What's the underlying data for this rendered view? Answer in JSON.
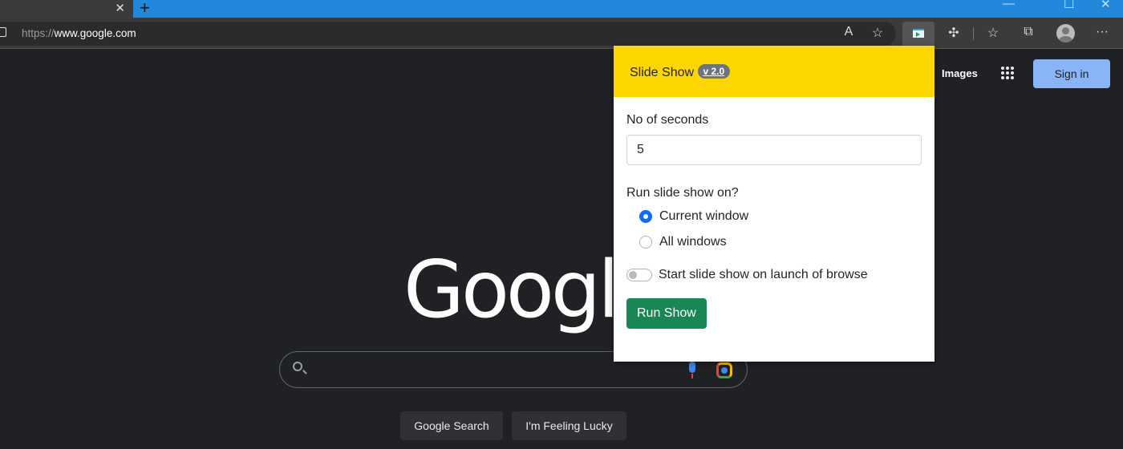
{
  "browser": {
    "tab_close": "✕",
    "new_tab": "+",
    "url_scheme": "https://",
    "url_host": "www.google.com",
    "window_controls": {
      "minimize": "—",
      "maximize": "☐",
      "close": "✕"
    },
    "toolbar_icons": [
      "read-aloud-icon",
      "add-favorite-icon",
      "slideshow-extension-icon",
      "extensions-icon",
      "favorites-icon",
      "collections-icon",
      "profile-icon",
      "more-icon"
    ]
  },
  "google": {
    "images_link": "Images",
    "sign_in": "Sign in",
    "logo": "Google",
    "search_button": "Google Search",
    "lucky_button": "I'm Feeling Lucky"
  },
  "popup": {
    "title": "Slide Show",
    "version": "v 2.0",
    "seconds_label": "No of seconds",
    "seconds_value": "5",
    "run_on_label": "Run slide show on?",
    "options": [
      {
        "label": "Current window",
        "checked": true
      },
      {
        "label": "All windows",
        "checked": false
      }
    ],
    "launch_toggle_label": "Start slide show on launch of browse",
    "launch_toggle_on": false,
    "run_button": "Run Show",
    "colors": {
      "header": "#ffd700",
      "run": "#198754",
      "radio": "#0d6efd"
    }
  }
}
